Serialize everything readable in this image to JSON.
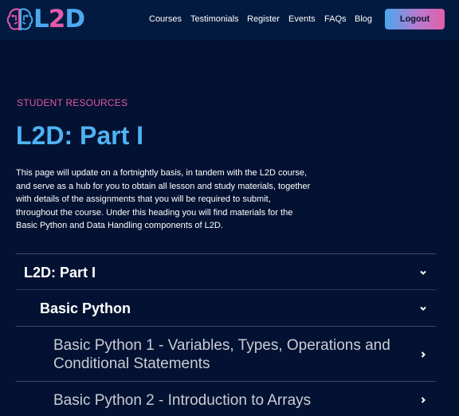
{
  "header": {
    "logo": {
      "l": "L",
      "two": "2",
      "d": "D"
    },
    "nav": [
      "Courses",
      "Testimonials",
      "Register",
      "Events",
      "FAQs",
      "Blog"
    ],
    "logout_label": "Logout"
  },
  "main": {
    "eyebrow": "STUDENT RESOURCES",
    "title": "L2D: Part I",
    "intro": "This page will update on a fortnightly basis, in tandem with the L2D course, and serve as a hub for you to obtain all lesson and study materials, together with details of the assignments that you will be required to submit, throughout the course. Under this heading you will find materials for the Basic Python and Data Handling components of L2D.",
    "accordion": {
      "section": "L2D: Part I",
      "subsection": "Basic Python",
      "lessons": [
        "Basic Python 1 - Variables, Types, Operations and Conditional Statements",
        "Basic Python 2 - Introduction to Arrays"
      ]
    }
  },
  "colors": {
    "background": "#031232",
    "header": "#021a3f",
    "accent_blue": "#4fb3f3",
    "accent_pink": "#e3569f"
  }
}
